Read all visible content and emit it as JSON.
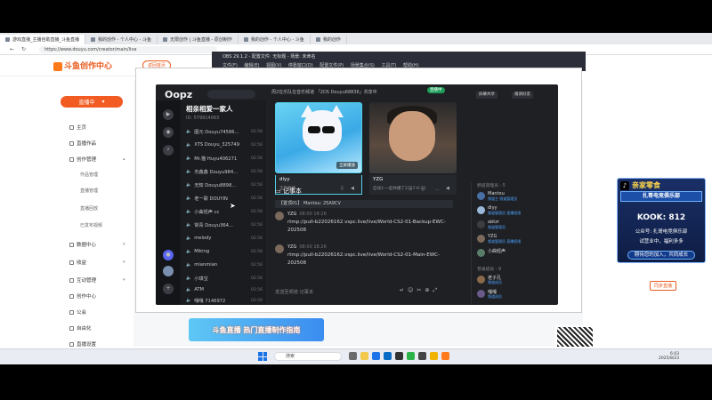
{
  "browser": {
    "tabs": [
      {
        "label": "游戏直播_主播自助直播_斗鱼直播"
      },
      {
        "label": "我的创作 - 个人中心 - 斗鱼"
      },
      {
        "label": "无限创作 | 斗鱼直播 - 原创制作"
      },
      {
        "label": "我的创作 - 个人中心 - 斗鱼"
      },
      {
        "label": "我的创作"
      }
    ],
    "url": "https://www.douyu.com/creator/main/live"
  },
  "creator_site": {
    "logo": "斗鱼创作中心",
    "return_label": "返回首页",
    "publish_label": "直播中",
    "nav": [
      {
        "label": "主页"
      },
      {
        "label": "直播作品"
      },
      {
        "label": "创作管理"
      },
      {
        "label": "数据中心"
      },
      {
        "label": "收益"
      },
      {
        "label": "互动管理"
      },
      {
        "label": "创作中心"
      },
      {
        "label": "公会"
      },
      {
        "label": "自由化"
      },
      {
        "label": "直播设置"
      }
    ],
    "nav_sub": [
      "作品管理",
      "直播管理",
      "直播回放",
      "已发布视频"
    ],
    "banner": "斗鱼直播 热门直播制作指南",
    "right_follow_btn": "同步直播"
  },
  "obs": {
    "title": "OBS 29.1.2 - 配置文件: 无标题 - 场景: 未命名",
    "menu": "文件(F) 编辑(E) 视图(V) 停靠窗口(D) 配置文件(P) 场景集合(S) 工具(T) 帮助(H)"
  },
  "kook_overlay": {
    "top": "亲家零食",
    "title": "扎哥电竞俱乐部",
    "number_line": "KOOK: 812",
    "line1": "公众号: 扎哥电竞俱乐部",
    "line2": "试营业中，福利多多",
    "button": "期待您的加入，共同成长"
  },
  "oopz": {
    "brand": "Oopz",
    "server": {
      "name": "相亲相爱一家人",
      "id": "ID: 579914063"
    },
    "channels": [
      {
        "name": "图元 Douyu74586...",
        "time": "02:56"
      },
      {
        "name": "XTS Douyu_325749",
        "time": "02:56"
      },
      {
        "name": "Mr.猫 Huyu406271",
        "time": "02:56"
      },
      {
        "name": "杰鑫鑫 Douyu984...",
        "time": "02:56"
      },
      {
        "name": "无知 Douyu8898...",
        "time": "02:56"
      },
      {
        "name": "老一歌 DOUYIN",
        "time": "02:56"
      },
      {
        "name": "小曲轻声 cc",
        "time": "02:56"
      },
      {
        "name": "常青 Douyu364...",
        "time": "02:56"
      },
      {
        "name": "melody",
        "time": "02:56"
      },
      {
        "name": "Miking",
        "time": "02:56"
      },
      {
        "name": "mianmian",
        "time": "02:56"
      },
      {
        "name": "小琪宝",
        "time": "02:56"
      },
      {
        "name": "ATM",
        "time": "02:56"
      },
      {
        "name": "嘎嘎 7146972",
        "time": "02:56"
      }
    ],
    "header_text": "周2在乐队在音乐频道 「2DS Douyu68836」共享中",
    "live_badge": "直播中",
    "header_buttons": [
      "屏幕共享",
      "邀请好友"
    ],
    "tiles": [
      {
        "name": "dlyy",
        "sub": "正在直播",
        "fullscreen": "全屏播放"
      },
      {
        "name": "YZG",
        "sub": "启动1-一起共播了2357-0:20",
        "fullscreen": ""
      }
    ],
    "notes_title": "记事本",
    "pinned": "【置顶01】 Mantou: 25A9CV",
    "messages": [
      {
        "user": "YZG",
        "time": "08:00 18:26",
        "text": "rtmp://pull-b22026162.vspc.live/live/World-CS2-01-Backup-EWC-202508"
      },
      {
        "user": "YZG",
        "time": "08:00 18:26",
        "text": "rtmp://pull-b22026162.vspc.live/live/World-CS2-01-Main-EWC-202508"
      }
    ],
    "composer_placeholder": "发送至频道 记事本",
    "members_header": "频道管理员 - 5",
    "members": [
      {
        "name": "Mantou",
        "tag": "频道主 频道管理员"
      },
      {
        "name": "dlyy",
        "tag": "频道管理员 直播权限"
      },
      {
        "name": "abtzr",
        "tag": "频道管理员"
      },
      {
        "name": "YZG",
        "tag": "频道管理员 直播权限"
      },
      {
        "name": "小曲轻声",
        "tag": ""
      }
    ],
    "members_header2": "普通成员 - 9",
    "members2": [
      {
        "name": "老子孔",
        "tag": "频道成员"
      },
      {
        "name": "嘎嘎",
        "tag": "频道成员"
      }
    ]
  },
  "taskbar": {
    "search": "搜索",
    "time": "6:03",
    "date": "2025/8/23"
  }
}
